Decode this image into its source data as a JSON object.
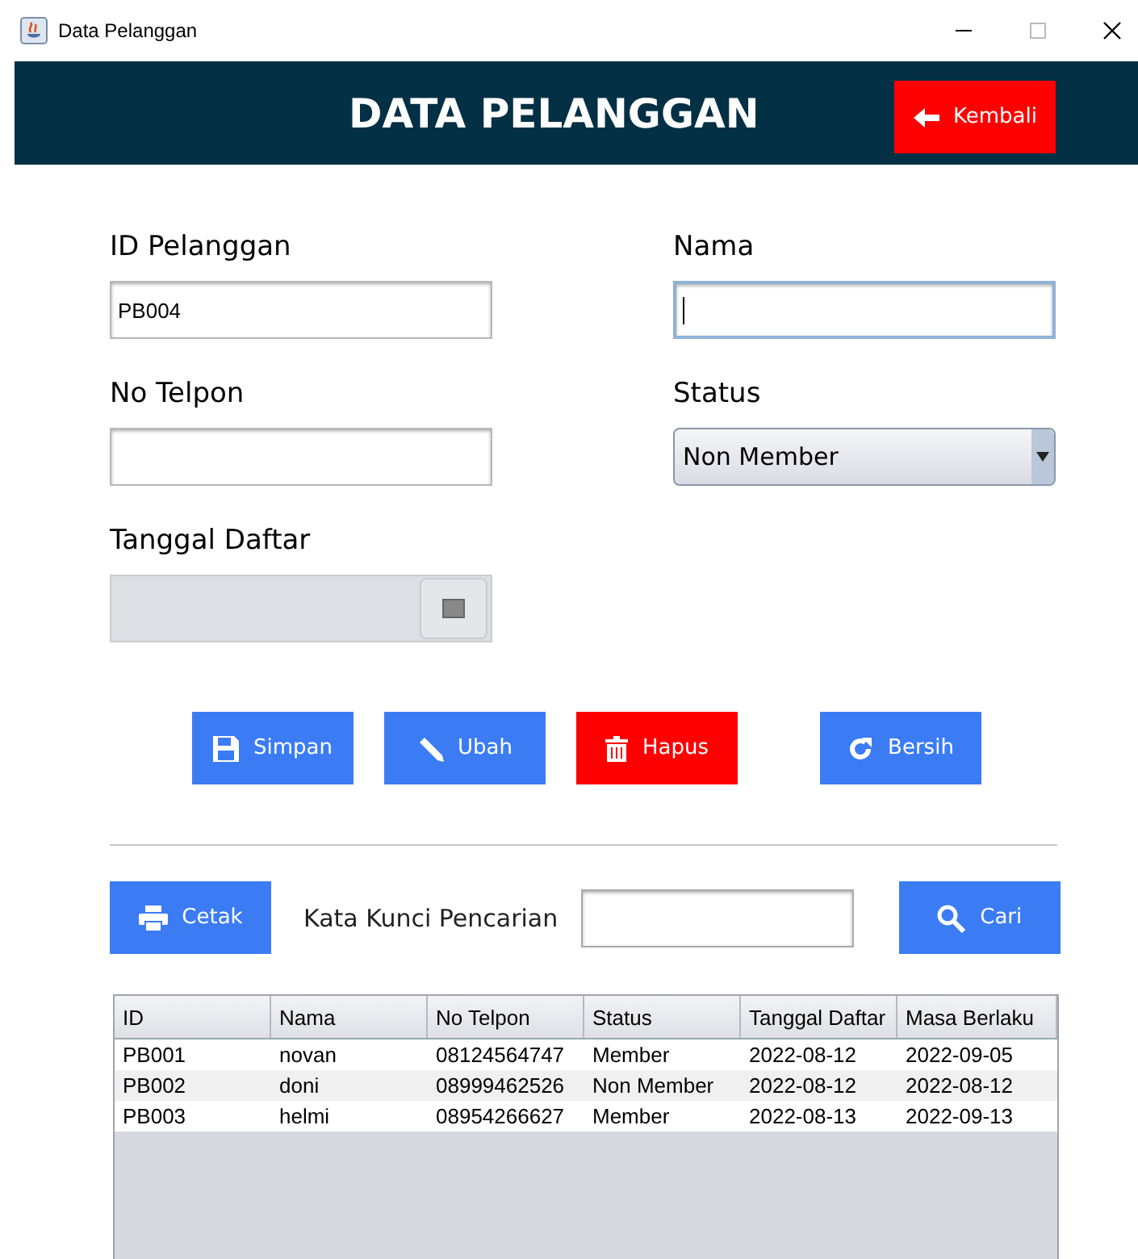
{
  "window": {
    "title": "Data Pelanggan"
  },
  "header": {
    "title": "DATA PELANGGAN",
    "back_button": "Kembali"
  },
  "form": {
    "id_label": "ID Pelanggan",
    "id_value": "PB004",
    "name_label": "Nama",
    "name_focused": true,
    "phone_label": "No Telpon",
    "status_label": "Status",
    "status_value": "Non Member",
    "date_label": "Tanggal Daftar",
    "date_disabled": true
  },
  "actions": [
    {
      "label": "Simpan",
      "kind": "primary"
    },
    {
      "label": "Ubah",
      "kind": "primary"
    },
    {
      "label": "Hapus",
      "kind": "danger"
    },
    {
      "label": "Bersih",
      "kind": "primary"
    }
  ],
  "search": {
    "print_button": "Cetak",
    "label": "Kata Kunci Pencarian",
    "search_button": "Cari"
  },
  "table": {
    "columns": [
      "ID",
      "Nama",
      "No Telpon",
      "Status",
      "Tanggal Daftar",
      "Masa Berlaku"
    ],
    "rows": [
      [
        "PB001",
        "novan",
        "08124564747",
        "Member",
        "2022-08-12",
        "2022-09-05"
      ],
      [
        "PB002",
        "doni",
        "08999462526",
        "Non Member",
        "2022-08-12",
        "2022-08-12"
      ],
      [
        "PB003",
        "helmi",
        "08954266627",
        "Member",
        "2022-08-13",
        "2022-09-13"
      ]
    ]
  }
}
